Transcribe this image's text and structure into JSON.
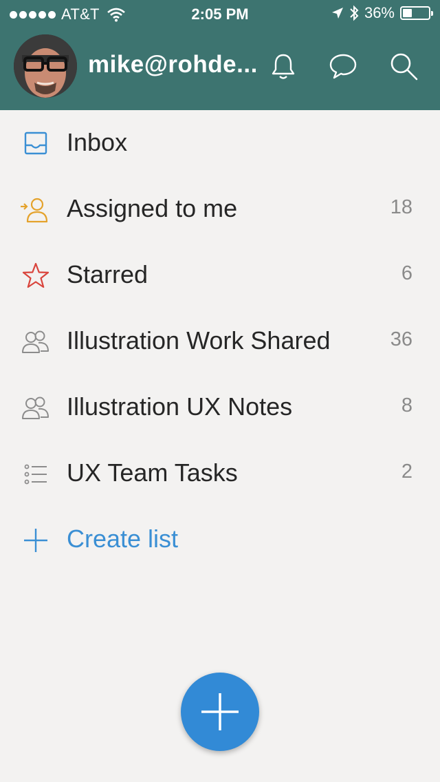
{
  "status_bar": {
    "carrier": "AT&T",
    "time": "2:05 PM",
    "battery_percent": "36%",
    "battery_level": 0.36
  },
  "header": {
    "username": "mike@rohde..."
  },
  "lists": [
    {
      "label": "Inbox",
      "count": "",
      "icon": "inbox-icon"
    },
    {
      "label": "Assigned to me",
      "count": "18",
      "icon": "assigned-user-icon"
    },
    {
      "label": "Starred",
      "count": "6",
      "icon": "star-icon"
    },
    {
      "label": "Illustration Work Shared",
      "count": "36",
      "icon": "shared-users-icon"
    },
    {
      "label": "Illustration UX Notes",
      "count": "8",
      "icon": "shared-users-icon"
    },
    {
      "label": "UX Team Tasks",
      "count": "2",
      "icon": "list-icon"
    }
  ],
  "create_list": {
    "label": "Create list",
    "icon": "plus-icon"
  },
  "colors": {
    "header": "#3d7470",
    "accent": "#328ad6",
    "inbox_icon": "#3a8fd4",
    "assigned_icon": "#e4a22b",
    "star_icon": "#d9443c",
    "background": "#f3f2f1"
  }
}
